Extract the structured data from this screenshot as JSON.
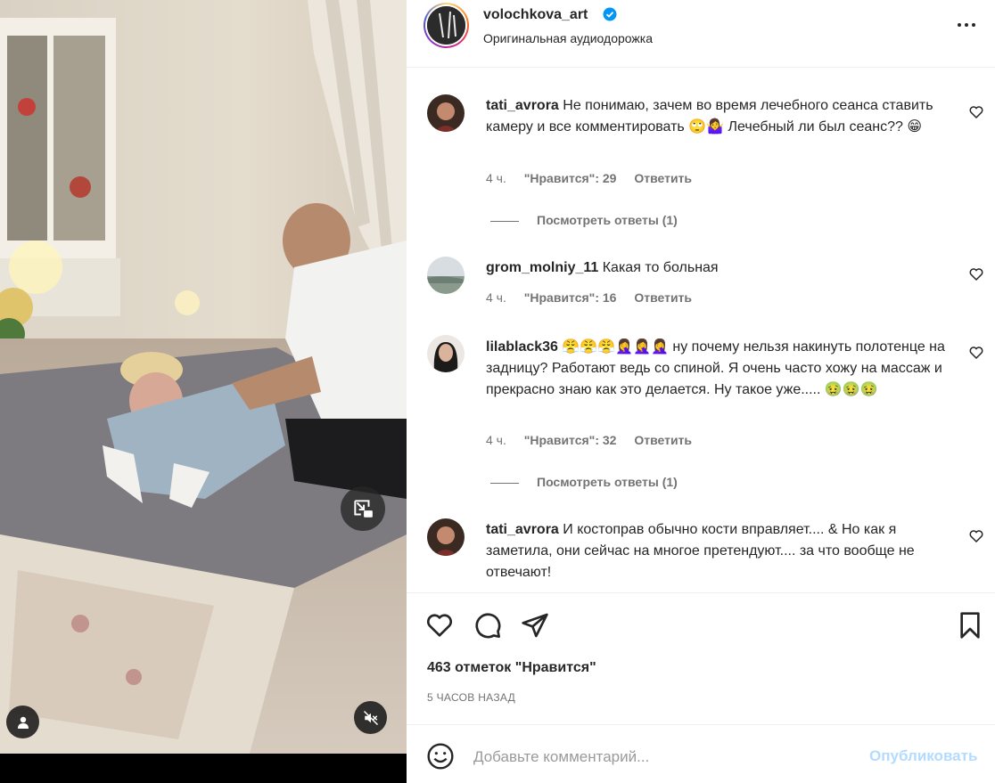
{
  "media": {
    "icons": {
      "pip": "picture-in-picture-icon",
      "tags": "user-tag-icon",
      "audio": "muted-speaker-icon"
    }
  },
  "header": {
    "username": "volochkova_art",
    "verified": true,
    "audio_label": "Оригинальная аудиодорожка",
    "more_icon": "more-options-icon"
  },
  "comments": [
    {
      "username": "tati_avrora",
      "text": "Не понимаю, зачем во время лечебного сеанса ставить камеру и все комментировать 🙄🤷‍♀️ Лечебный ли был сеанс?? 😁",
      "time": "4 ч.",
      "likes": "\"Нравится\": 29",
      "reply": "Ответить",
      "view_replies": "Посмотреть ответы (1)"
    },
    {
      "username": "grom_molniy_11",
      "text": "Какая то больная",
      "time": "4 ч.",
      "likes": "\"Нравится\": 16",
      "reply": "Ответить"
    },
    {
      "username": "lilablack36",
      "text": "😤😤😤🤦‍♀️🤦‍♀️🤦‍♀️ ну почему нельзя накинуть полотенце на задницу? Работают ведь со спиной. Я очень часто хожу на массаж и прекрасно знаю как это делается. Ну такое уже..... 🤢🤢🤢",
      "time": "4 ч.",
      "likes": "\"Нравится\": 32",
      "reply": "Ответить",
      "view_replies": "Посмотреть ответы (1)"
    },
    {
      "username": "tati_avrora",
      "text": "И костоправ обычно кости вправляет.... & Но как я заметила, они сейчас на многое претендуют.... за что вообще не отвечают!"
    }
  ],
  "actions": {
    "icons": [
      "heart-icon",
      "comment-icon",
      "share-icon",
      "bookmark-icon"
    ],
    "likes": "463 отметок \"Нравится\"",
    "timeago": "5 ЧАСОВ НАЗАД"
  },
  "compose": {
    "placeholder": "Добавьте комментарий...",
    "publish": "Опубликовать",
    "emoji_icon": "emoji-smile-icon"
  },
  "colors": {
    "text": "#262626",
    "secondary": "#737373",
    "publish_disabled": "#b3dbff",
    "verified": "#0095f6",
    "divider": "#efefef"
  }
}
